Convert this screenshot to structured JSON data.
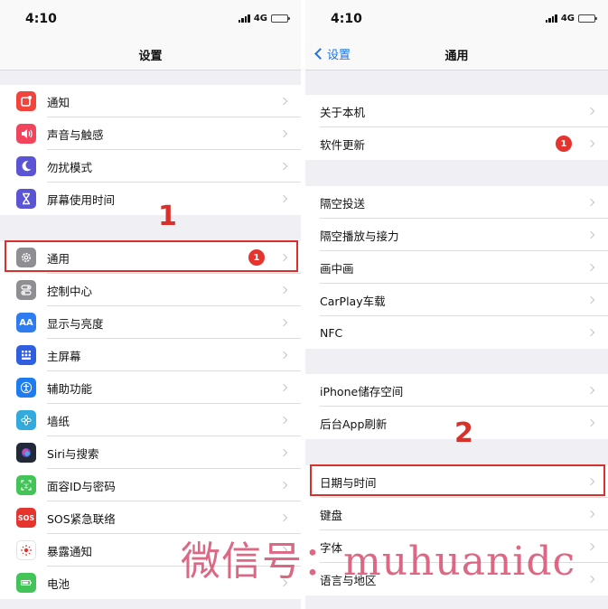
{
  "status_bar": {
    "time": "4:10",
    "network": "4G"
  },
  "left_screen": {
    "title": "设置",
    "groups": [
      [
        {
          "label": "通知",
          "icon": "notifications-icon",
          "color": "#f0443c"
        },
        {
          "label": "声音与触感",
          "icon": "sound-icon",
          "color": "#f2455d"
        },
        {
          "label": "勿扰模式",
          "icon": "moon-icon",
          "color": "#5b55d6"
        },
        {
          "label": "屏幕使用时间",
          "icon": "hourglass-icon",
          "color": "#5b55d6"
        }
      ],
      [
        {
          "label": "通用",
          "icon": "gear-icon",
          "color": "#8e8e93",
          "badge": "1"
        },
        {
          "label": "控制中心",
          "icon": "toggles-icon",
          "color": "#8e8e93"
        },
        {
          "label": "显示与亮度",
          "icon": "text-size-icon",
          "color": "#2f7bf0",
          "icon_text": "AA"
        },
        {
          "label": "主屏幕",
          "icon": "home-grid-icon",
          "color": "#2f5ee0"
        },
        {
          "label": "辅助功能",
          "icon": "accessibility-icon",
          "color": "#1f7cf0"
        },
        {
          "label": "墙纸",
          "icon": "flower-icon",
          "color": "#33aadc"
        },
        {
          "label": "Siri与搜索",
          "icon": "siri-icon",
          "color": "#222a3a"
        },
        {
          "label": "面容ID与密码",
          "icon": "face-id-icon",
          "color": "#44c359"
        },
        {
          "label": "SOS紧急联络",
          "icon": "sos-icon",
          "color": "#e5342d",
          "icon_text": "SOS"
        },
        {
          "label": "暴露通知",
          "icon": "exposure-icon",
          "color": "#ffffff"
        },
        {
          "label": "电池",
          "icon": "battery-app-icon",
          "color": "#44c359"
        }
      ]
    ],
    "step_label": "1"
  },
  "right_screen": {
    "back_label": "设置",
    "title": "通用",
    "groups": [
      [
        {
          "label": "关于本机"
        },
        {
          "label": "软件更新",
          "badge": "1"
        }
      ],
      [
        {
          "label": "隔空投送"
        },
        {
          "label": "隔空播放与接力"
        },
        {
          "label": "画中画"
        },
        {
          "label": "CarPlay车载"
        },
        {
          "label": "NFC"
        }
      ],
      [
        {
          "label": "iPhone储存空间"
        },
        {
          "label": "后台App刷新"
        }
      ],
      [
        {
          "label": "日期与时间"
        },
        {
          "label": "键盘"
        },
        {
          "label": "字体"
        },
        {
          "label": "语言与地区"
        }
      ]
    ],
    "step_label": "2"
  },
  "watermark": "微信号：muhuanidc"
}
